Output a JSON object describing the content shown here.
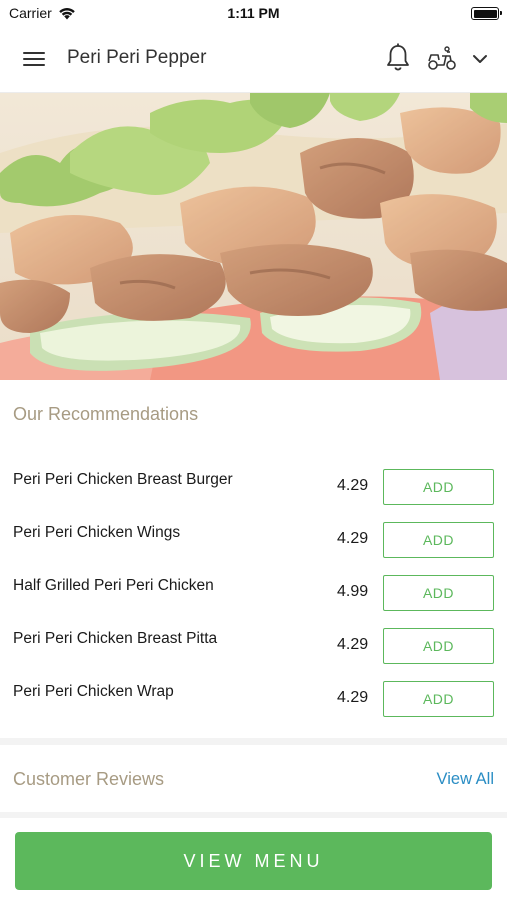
{
  "status_bar": {
    "carrier": "Carrier",
    "time": "1:11 PM"
  },
  "header": {
    "title": "Peri Peri Pepper",
    "icons": [
      "menu-icon",
      "bell-icon",
      "scooter-icon",
      "chevron-down-icon"
    ]
  },
  "recommendations": {
    "title": "Our Recommendations",
    "items": [
      {
        "name": "Peri Peri Chicken Breast Burger",
        "price": "4.29",
        "button": "ADD"
      },
      {
        "name": "Peri Peri Chicken Wings",
        "price": "4.29",
        "button": "ADD"
      },
      {
        "name": "Half Grilled Peri Peri Chicken",
        "price": "4.99",
        "button": "ADD"
      },
      {
        "name": "Peri Peri Chicken Breast Pitta",
        "price": "4.29",
        "button": "ADD"
      },
      {
        "name": "Peri Peri Chicken Wrap",
        "price": "4.29",
        "button": "ADD"
      }
    ]
  },
  "reviews": {
    "title": "Customer Reviews",
    "view_all": "View All"
  },
  "footer": {
    "view_menu": "VIEW MENU"
  },
  "colors": {
    "accent_green": "#5cb85c",
    "section_title": "#a79b83",
    "link_blue": "#2a8dc4"
  }
}
